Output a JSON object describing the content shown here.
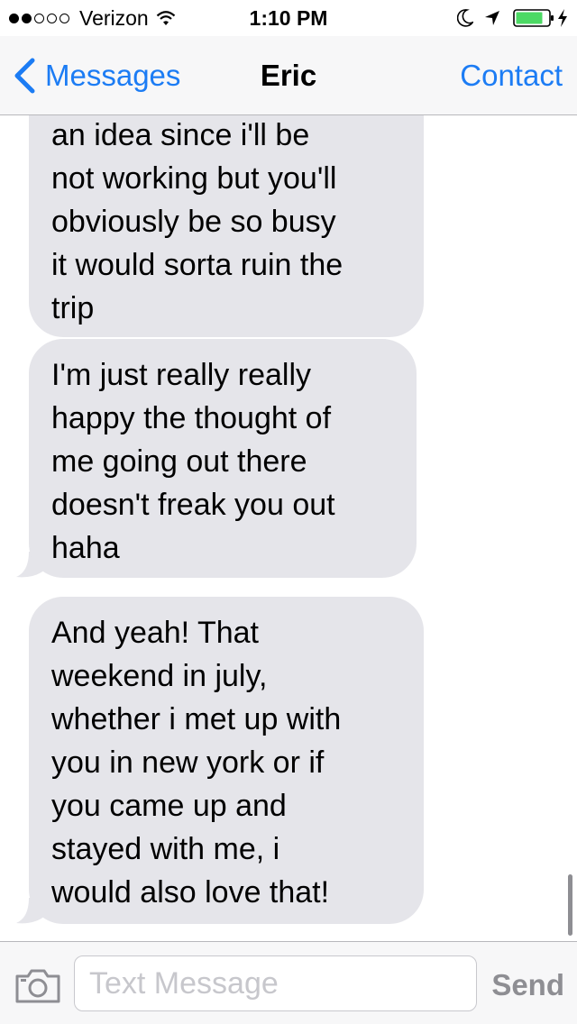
{
  "status_bar": {
    "carrier": "Verizon",
    "time": "1:10 PM",
    "signal_filled": 2,
    "signal_total": 5,
    "icons": [
      "wifi-icon",
      "moon-icon",
      "location-icon",
      "battery-icon",
      "charging-bolt-icon"
    ]
  },
  "nav": {
    "back_label": "Messages",
    "title": "Eric",
    "contact_label": "Contact",
    "icons": [
      "chevron-left-icon"
    ]
  },
  "messages": [
    {
      "direction": "incoming",
      "text": "an idea since i'll be\nnot working but you'll\nobviously be so busy\nit would sorta ruin the\ntrip"
    },
    {
      "direction": "incoming",
      "text": "I'm just really really\nhappy the thought of\nme going out there\ndoesn't freak you out\nhaha"
    },
    {
      "direction": "incoming",
      "text": "And yeah! That\nweekend in july,\nwhether i met up with\nyou in new york or if\nyou came up and\nstayed with me, i\nwould also love that!"
    }
  ],
  "input_bar": {
    "placeholder": "Text Message",
    "value": "",
    "send_label": "Send",
    "icons": [
      "camera-icon"
    ]
  },
  "colors": {
    "accent": "#1c7cf4",
    "bubble_incoming": "#e5e5ea",
    "bar_background": "#f7f7f8",
    "send_disabled": "#8e8e93",
    "battery_fill": "#4cd964"
  }
}
